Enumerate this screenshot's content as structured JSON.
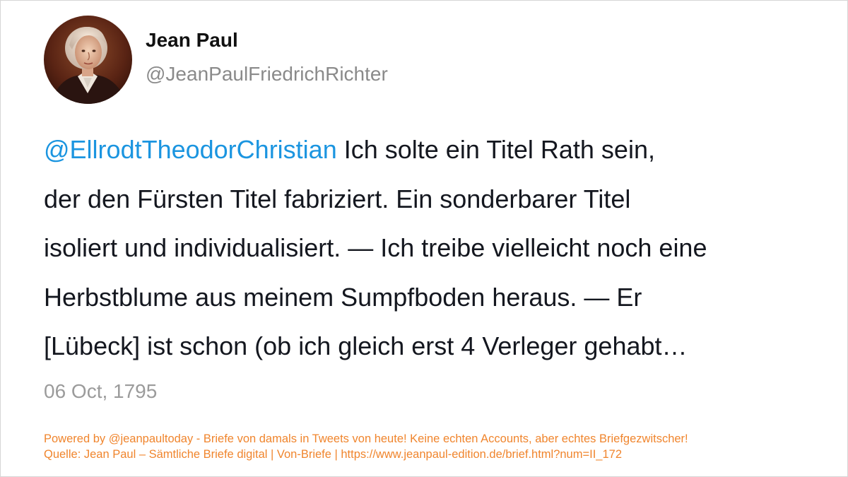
{
  "author": {
    "name": "Jean Paul",
    "handle": "@JeanPaulFriedrichRichter"
  },
  "tweet": {
    "mention": "@EllrodtTheodorChristian",
    "line1_rest": " Ich solte ein Titel Rath sein,",
    "line2": "der den Fürsten Titel fabriziert. Ein sonderbarer Titel",
    "line3": "isoliert und individualisiert. — Ich treibe vielleicht noch eine",
    "line4": "Herbstblume aus meinem Sumpfboden heraus. — Er",
    "line5": "[Lübeck] ist schon (ob ich gleich erst 4 Verleger gehabt…",
    "date": "06 Oct, 1795"
  },
  "footer": {
    "powered_by": "Powered by @jeanpaultoday - Briefe von damals in Tweets von heute! Keine echten Accounts, aber echtes Briefgezwitscher!",
    "source": "Quelle: Jean Paul – Sämtliche Briefe digital | Von-Briefe | https://www.jeanpaul-edition.de/brief.html?num=II_172"
  },
  "colors": {
    "mention": "#1b95e0",
    "footer": "#f0852d",
    "muted": "#9b9b9b"
  },
  "icons": {
    "avatar": "portrait-avatar"
  }
}
